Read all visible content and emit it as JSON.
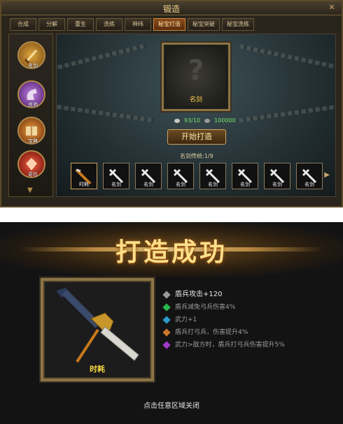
{
  "window": {
    "title": "锻造",
    "close_glyph": "✕"
  },
  "tabs": [
    {
      "label": "合成",
      "active": false
    },
    {
      "label": "分解",
      "active": false
    },
    {
      "label": "重生",
      "active": false
    },
    {
      "label": "洗练",
      "active": false
    },
    {
      "label": "神纬",
      "active": false
    },
    {
      "label": "秘宝打造",
      "active": true
    },
    {
      "label": "秘宝突破",
      "active": false
    },
    {
      "label": "秘宝洗练",
      "active": false
    }
  ],
  "sidebar": {
    "items": [
      {
        "label": "名剑",
        "icon": "sword-icon",
        "color": "#c98c2a"
      },
      {
        "label": "良驹",
        "icon": "horse-icon",
        "color": "#7a4a9a"
      },
      {
        "label": "宝典",
        "icon": "book-icon",
        "color": "#b8621c"
      },
      {
        "label": "奇珍",
        "icon": "gem-icon",
        "color": "#b8281c"
      }
    ],
    "more_glyph": "▼"
  },
  "forge": {
    "slot_name": "名剑",
    "slot_placeholder": "?",
    "cost_a": "93/10",
    "cost_b": "100000",
    "button_label": "开始打造",
    "progress_label": "名剑传统:1/9"
  },
  "strip": {
    "items": [
      {
        "label": "时耗",
        "highlight": true
      },
      {
        "label": "名剑",
        "highlight": false
      },
      {
        "label": "名剑",
        "highlight": false
      },
      {
        "label": "名剑",
        "highlight": false
      },
      {
        "label": "名剑",
        "highlight": false
      },
      {
        "label": "名剑",
        "highlight": false
      },
      {
        "label": "名剑",
        "highlight": false
      },
      {
        "label": "名剑",
        "highlight": false
      }
    ],
    "next_glyph": "▶"
  },
  "popup": {
    "title": "打造成功",
    "item_name": "时耗",
    "stats": [
      {
        "text": "盾兵攻击+120",
        "color": "#9a9a9a"
      },
      {
        "text": "盾兵减免弓兵伤害4%",
        "color": "#2ab84a"
      },
      {
        "text": "武力+1",
        "color": "#2a9ac8"
      },
      {
        "text": "盾兵打弓兵，伤害提升4%",
        "color": "#c8782a"
      },
      {
        "text": "武力>敌方时，盾兵打弓兵伤害提升5%",
        "color": "#a03ac8"
      }
    ],
    "close_hint": "点击任意区域关闭"
  }
}
